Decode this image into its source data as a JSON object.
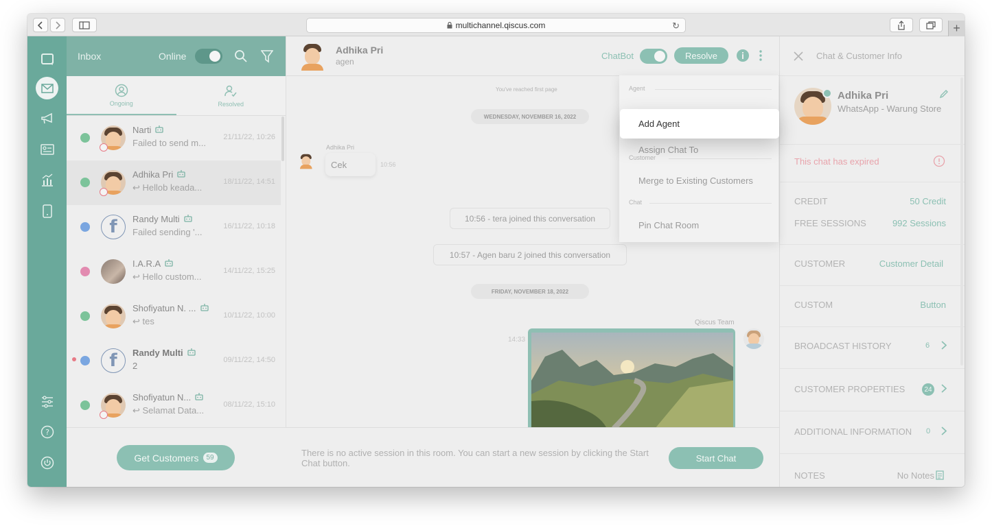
{
  "browser": {
    "url": "multichannel.qiscus.com"
  },
  "inbox": {
    "title": "Inbox",
    "status_label": "Online",
    "tabs": [
      {
        "label": "Ongoing"
      },
      {
        "label": "Resolved"
      }
    ],
    "conversations": [
      {
        "name": "Narti",
        "message": "Failed to send m...",
        "time": "21/11/22, 10:26",
        "channel": "whatsapp",
        "avatar": "person",
        "bold": false,
        "error": true
      },
      {
        "name": "Adhika Pri",
        "message": "Hellob keada...",
        "time": "18/11/22, 14:51",
        "channel": "whatsapp",
        "avatar": "person",
        "bold": false,
        "error": true,
        "reply": true
      },
      {
        "name": "Randy Multi",
        "message": "Failed sending '...",
        "time": "16/11/22, 10:18",
        "channel": "messenger",
        "avatar": "facebook",
        "bold": false
      },
      {
        "name": "I.A.R.A",
        "message": "Hello custom...",
        "time": "14/11/22, 15:25",
        "channel": "instagram",
        "avatar": "photo",
        "bold": false,
        "reply": true
      },
      {
        "name": "Shofiyatun N. ...",
        "message": "tes",
        "time": "10/11/22, 10:00",
        "channel": "line",
        "avatar": "person",
        "bold": false,
        "reply": true
      },
      {
        "name": "Randy Multi",
        "message": "2",
        "time": "09/11/22, 14:50",
        "channel": "messenger",
        "avatar": "facebook",
        "bold": true,
        "unread": true
      },
      {
        "name": "Shofiyatun N...",
        "message": "Selamat Data...",
        "time": "08/11/22, 15:10",
        "channel": "whatsapp",
        "avatar": "person",
        "bold": false,
        "error": true,
        "reply": true
      }
    ],
    "get_customers_label": "Get Customers",
    "get_customers_count": "59"
  },
  "chat": {
    "contact_name": "Adhika Pri",
    "contact_role": "agen",
    "chatbot_label": "ChatBot",
    "resolve_label": "Resolve",
    "first_page_notice": "You've reached first page",
    "date1": "WEDNESDAY, NOVEMBER 16, 2022",
    "msg_sender": "Adhika Pri",
    "msg_text": "Cek",
    "msg_time": "10:56",
    "sys1": "10:56 - tera joined this conversation",
    "sys2": "10:57 - Agen baru 2 joined this conversation",
    "date2": "FRIDAY, NOVEMBER 18, 2022",
    "team_label": "Qiscus Team",
    "img_time": "14:33",
    "no_session_text": "There is no active session in this room. You can start a new session by clicking the Start Chat button.",
    "start_chat_label": "Start Chat"
  },
  "menu": {
    "sections": [
      {
        "title": "Agent",
        "items": [
          "Add Agent",
          "Assign Chat To"
        ]
      },
      {
        "title": "Customer",
        "items": [
          "Merge to Existing Customers"
        ]
      },
      {
        "title": "Chat",
        "items": [
          "Pin Chat Room"
        ]
      }
    ]
  },
  "info": {
    "panel_title": "Chat & Customer Info",
    "name": "Adhika Pri",
    "channel": "WhatsApp - Warung Store",
    "expired_notice": "This chat has expired",
    "credit_label": "CREDIT",
    "credit_value": "50 Credit",
    "sessions_label": "FREE SESSIONS",
    "sessions_value": "992 Sessions",
    "customer_label": "CUSTOMER",
    "customer_value": "Customer Detail",
    "custom_label": "CUSTOM",
    "custom_value": "Button",
    "broadcast_label": "BROADCAST HISTORY",
    "broadcast_count": "6",
    "properties_label": "CUSTOMER PROPERTIES",
    "properties_count": "24",
    "additional_label": "ADDITIONAL INFORMATION",
    "additional_count": "0",
    "notes_label": "NOTES",
    "notes_value": "No Notes"
  },
  "colors": {
    "accent": "#6aa99b",
    "accent_light": "#8cc0b3",
    "error": "#e77a86"
  }
}
